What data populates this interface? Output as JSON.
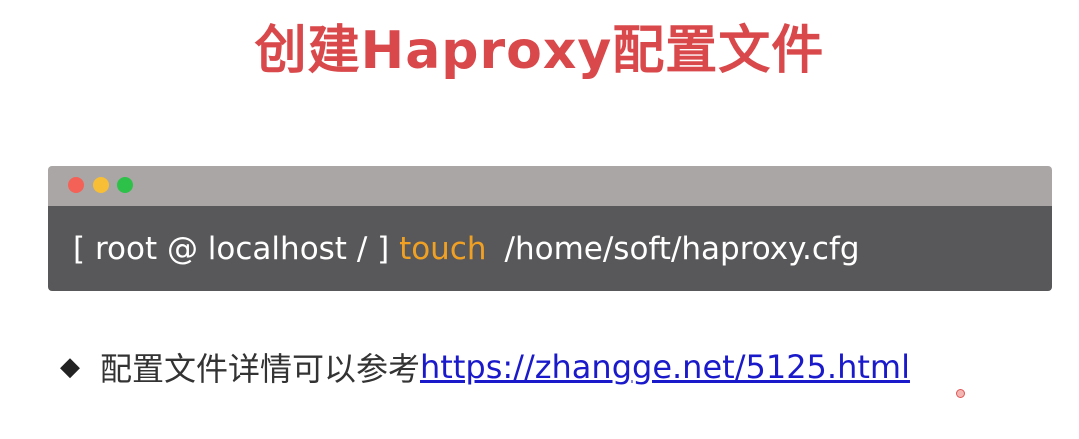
{
  "slide": {
    "title": "创建Haproxy配置文件"
  },
  "terminal": {
    "prompt": "[ root @ localhost / ] ",
    "command": "touch",
    "argument": "/home/soft/haproxy.cfg",
    "colors": {
      "titlebar": "#aaa6a6",
      "body": "#58585a",
      "command": "#f0a023",
      "dot_red": "#f46156",
      "dot_yellow": "#f7be36",
      "dot_green": "#2ec14a"
    }
  },
  "note": {
    "bullet": "◆",
    "text": "配置文件详情可以参考",
    "link": "https://zhangge.net/5125.html"
  },
  "colors": {
    "title": "#d9484b",
    "link": "#1a1acb"
  }
}
